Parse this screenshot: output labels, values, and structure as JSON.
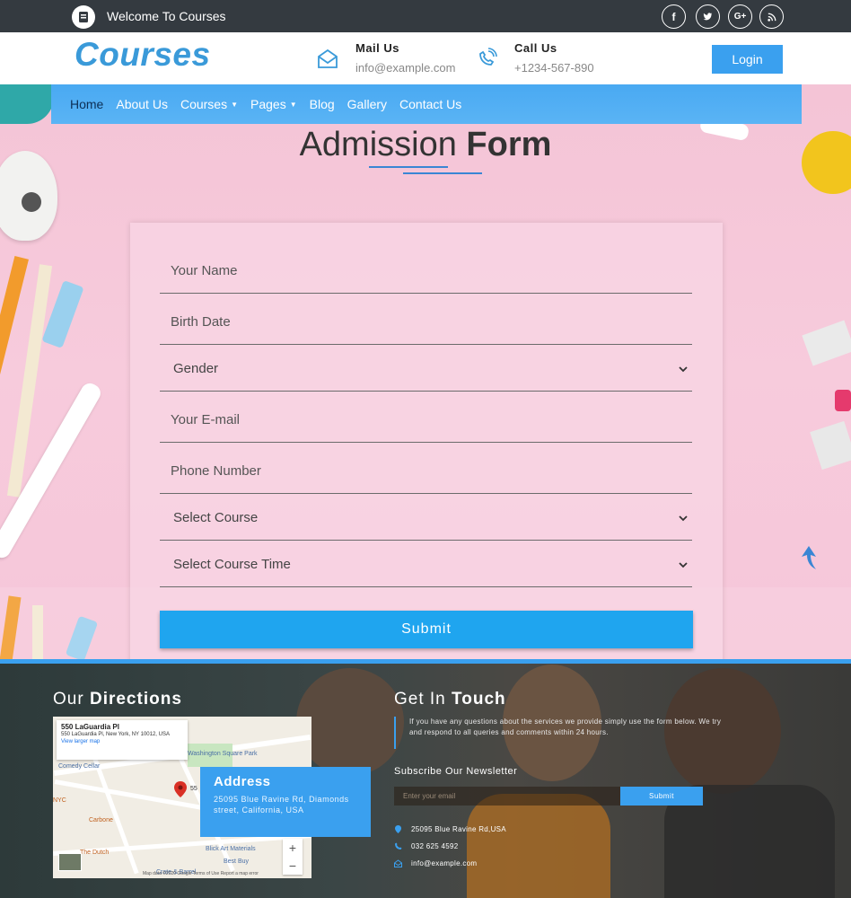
{
  "topbar": {
    "welcome": "Welcome To Courses",
    "social": [
      {
        "label": "f",
        "icon": "facebook-icon"
      },
      {
        "label": "t",
        "icon": "twitter-icon"
      },
      {
        "label": "G+",
        "icon": "google-plus-icon"
      },
      {
        "label": "rss",
        "icon": "rss-icon"
      }
    ]
  },
  "header": {
    "logo": "Courses",
    "mail": {
      "title": "Mail Us",
      "value": "info@example.com"
    },
    "call": {
      "title": "Call Us",
      "value": "+1234-567-890"
    },
    "login": "Login"
  },
  "nav": {
    "items": [
      "Home",
      "About Us",
      "Courses",
      "Pages",
      "Blog",
      "Gallery",
      "Contact Us"
    ]
  },
  "form": {
    "title_light": "Admission",
    "title_bold": "Form",
    "name_placeholder": "Your Name",
    "birth_placeholder": "Birth Date",
    "gender": "Gender",
    "email_placeholder": "Your E-mail",
    "phone_placeholder": "Phone Number",
    "course": "Select Course",
    "course_time": "Select Course Time",
    "submit": "Submit"
  },
  "footer": {
    "directions_light": "Our",
    "directions_bold": "Directions",
    "map": {
      "place": "550 LaGuardia Pl",
      "place_address": "550 LaGuardia Pl, New York, NY 10012, USA",
      "view_larger": "View larger map",
      "labels": [
        "Washington Square Park",
        "Comedy Cellar",
        "Carbone",
        "The Dutch",
        "Blick Art Materials",
        "Best Buy",
        "Crate & Barrel",
        "NYC"
      ],
      "pin_label": "55",
      "credit": "Map data ©2020 Google   Terms of Use   Report a map error"
    },
    "address": {
      "title": "Address",
      "text": "25095 Blue Ravine Rd, Diamonds street, California, USA"
    },
    "touch_light": "Get In",
    "touch_bold": "Touch",
    "touch_text": "If you have any questions about the services we provide simply use the form below. We try and respond to all queries and comments within 24 hours.",
    "newsletter_title": "Subscribe Our Newsletter",
    "newsletter_placeholder": "Enter your email",
    "newsletter_submit": "Submit",
    "contact_lines": {
      "address": "25095 Blue Ravine Rd,USA",
      "phone": "032 625 4592",
      "email": "info@example.com"
    }
  }
}
